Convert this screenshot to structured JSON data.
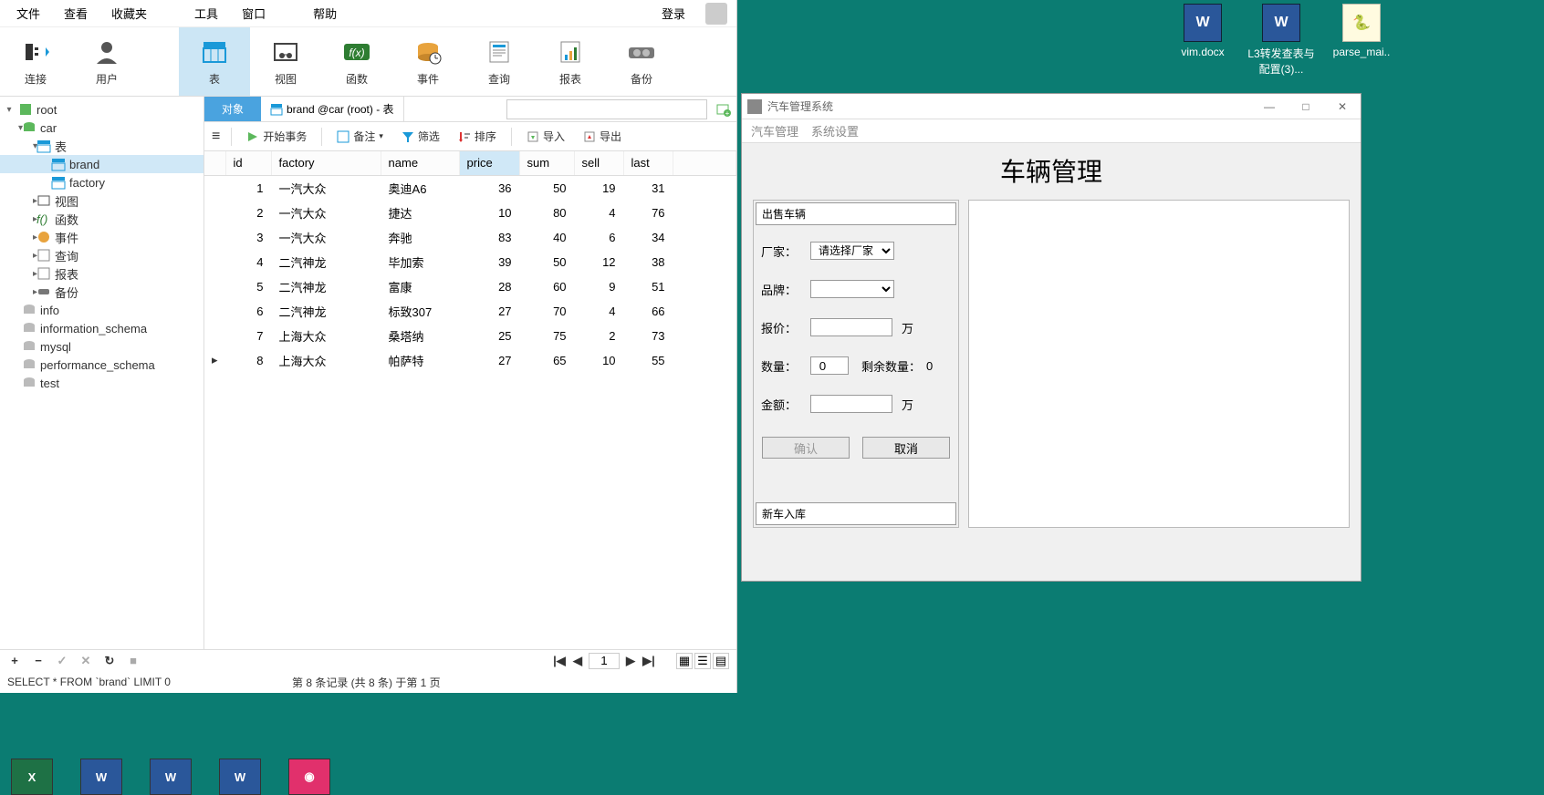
{
  "menubar": {
    "file": "文件",
    "view": "查看",
    "fav": "收藏夹",
    "tools": "工具",
    "window": "窗口",
    "help": "帮助",
    "login": "登录"
  },
  "toolbar": [
    {
      "label": "连接",
      "icon": "plug"
    },
    {
      "label": "用户",
      "icon": "user"
    },
    {
      "label": "表",
      "icon": "table",
      "active": true
    },
    {
      "label": "视图",
      "icon": "view"
    },
    {
      "label": "函数",
      "icon": "fx"
    },
    {
      "label": "事件",
      "icon": "event"
    },
    {
      "label": "查询",
      "icon": "query"
    },
    {
      "label": "报表",
      "icon": "report"
    },
    {
      "label": "备份",
      "icon": "backup"
    }
  ],
  "sidebar": {
    "root": "root",
    "car": "car",
    "tables": "表",
    "brand": "brand",
    "factory": "factory",
    "views": "视图",
    "funcs": "函数",
    "events": "事件",
    "queries": "查询",
    "reports": "报表",
    "backups": "备份",
    "info": "info",
    "is": "information_schema",
    "mysql": "mysql",
    "ps": "performance_schema",
    "test": "test"
  },
  "tabs": {
    "objects": "对象",
    "brand_tab": "brand @car (root) - 表"
  },
  "actionbar": {
    "begin": "开始事务",
    "remark": "备注",
    "filter": "筛选",
    "sort": "排序",
    "import": "导入",
    "export": "导出"
  },
  "columns": [
    "id",
    "factory",
    "name",
    "price",
    "sum",
    "sell",
    "last"
  ],
  "rows": [
    {
      "id": "1",
      "factory": "一汽大众",
      "name": "奥迪A6",
      "price": "36",
      "sum": "50",
      "sell": "19",
      "last": "31"
    },
    {
      "id": "2",
      "factory": "一汽大众",
      "name": "捷达",
      "price": "10",
      "sum": "80",
      "sell": "4",
      "last": "76"
    },
    {
      "id": "3",
      "factory": "一汽大众",
      "name": "奔驰",
      "price": "83",
      "sum": "40",
      "sell": "6",
      "last": "34"
    },
    {
      "id": "4",
      "factory": "二汽神龙",
      "name": "毕加索",
      "price": "39",
      "sum": "50",
      "sell": "12",
      "last": "38"
    },
    {
      "id": "5",
      "factory": "二汽神龙",
      "name": "富康",
      "price": "28",
      "sum": "60",
      "sell": "9",
      "last": "51"
    },
    {
      "id": "6",
      "factory": "二汽神龙",
      "name": "标致307",
      "price": "27",
      "sum": "70",
      "sell": "4",
      "last": "66"
    },
    {
      "id": "7",
      "factory": "上海大众",
      "name": "桑塔纳",
      "price": "25",
      "sum": "75",
      "sell": "2",
      "last": "73"
    },
    {
      "id": "8",
      "factory": "上海大众",
      "name": "帕萨特",
      "price": "27",
      "sum": "65",
      "sell": "10",
      "last": "55"
    }
  ],
  "footer": {
    "page": "1",
    "sql": "SELECT * FROM `brand` LIMIT 0",
    "recinfo": "第 8 条记录 (共 8 条) 于第 1 页"
  },
  "carapp": {
    "title": "汽车管理系统",
    "menu1": "汽车管理",
    "menu2": "系统设置",
    "heading": "车辆管理",
    "sell_head": "出售车辆",
    "factory_label": "厂家：",
    "factory_select": "请选择厂家",
    "brand_label": "品牌：",
    "price_label": "报价：",
    "unit_wan": "万",
    "qty_label": "数量：",
    "qty_value": "0",
    "remain_label": "剩余数量：",
    "remain_value": "0",
    "amount_label": "金额：",
    "ok": "确认",
    "cancel": "取消",
    "new_head": "新车入库"
  },
  "desktop": {
    "icon1": "vim.docx",
    "icon2": "L3转发查表与配置(3)...",
    "icon3": "parse_mai.."
  }
}
